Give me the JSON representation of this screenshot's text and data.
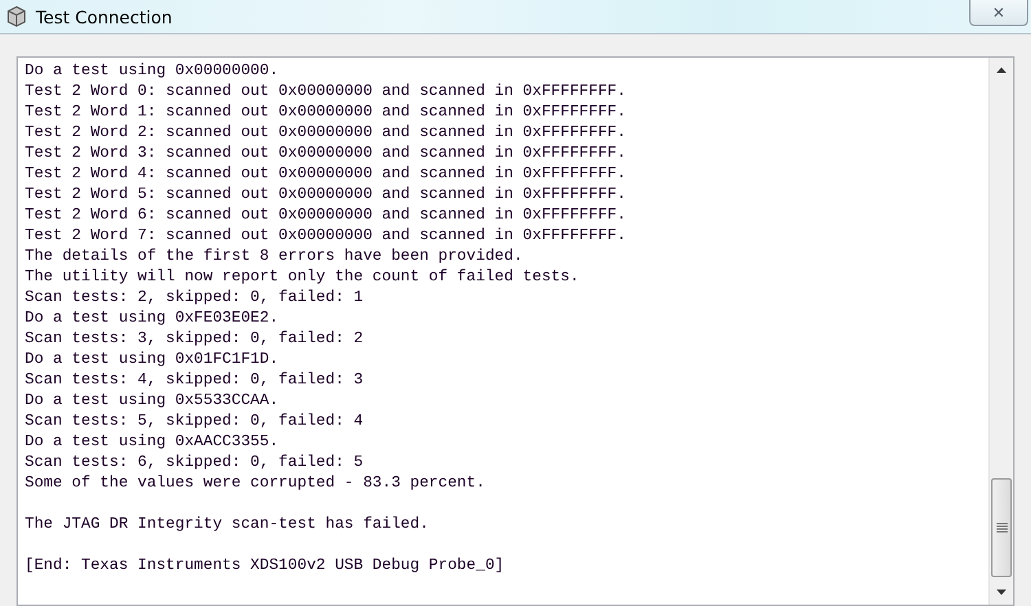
{
  "window": {
    "title": "Test Connection",
    "close_button": "✕"
  },
  "console": {
    "blocks": [
      [
        "Do a test using 0x00000000.",
        "Test 2 Word 0: scanned out 0x00000000 and scanned in 0xFFFFFFFF.",
        "Test 2 Word 1: scanned out 0x00000000 and scanned in 0xFFFFFFFF.",
        "Test 2 Word 2: scanned out 0x00000000 and scanned in 0xFFFFFFFF.",
        "Test 2 Word 3: scanned out 0x00000000 and scanned in 0xFFFFFFFF.",
        "Test 2 Word 4: scanned out 0x00000000 and scanned in 0xFFFFFFFF.",
        "Test 2 Word 5: scanned out 0x00000000 and scanned in 0xFFFFFFFF.",
        "Test 2 Word 6: scanned out 0x00000000 and scanned in 0xFFFFFFFF.",
        "Test 2 Word 7: scanned out 0x00000000 and scanned in 0xFFFFFFFF.",
        "The details of the first 8 errors have been provided.",
        "The utility will now report only the count of failed tests.",
        "Scan tests: 2, skipped: 0, failed: 1",
        "Do a test using 0xFE03E0E2.",
        "Scan tests: 3, skipped: 0, failed: 2",
        "Do a test using 0x01FC1F1D.",
        "Scan tests: 4, skipped: 0, failed: 3",
        "Do a test using 0x5533CCAA.",
        "Scan tests: 5, skipped: 0, failed: 4",
        "Do a test using 0xAACC3355.",
        "Scan tests: 6, skipped: 0, failed: 5",
        "Some of the values were corrupted - 83.3 percent."
      ],
      [
        "The JTAG DR Integrity scan-test has failed."
      ],
      [
        "[End: Texas Instruments XDS100v2 USB Debug Probe_0]"
      ]
    ]
  }
}
